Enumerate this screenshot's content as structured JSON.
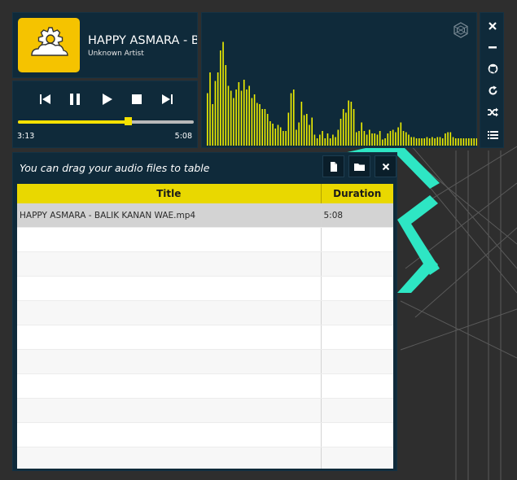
{
  "now_playing": {
    "title": "HAPPY ASMARA - BALIK KANAN WAE",
    "artist": "Unknown Artist",
    "cover_color": "#f5c300"
  },
  "controls": {
    "buttons": [
      "previous",
      "pause",
      "play",
      "stop",
      "next"
    ],
    "current_time": "3:13",
    "total_time": "5:08",
    "progress": 0.626
  },
  "visualizer": {
    "bar_color": "#f0f000",
    "levels": [
      0.43,
      0.6,
      0.34,
      0.53,
      0.6,
      0.78,
      0.85,
      0.66,
      0.49,
      0.45,
      0.39,
      0.46,
      0.52,
      0.45,
      0.54,
      0.46,
      0.49,
      0.39,
      0.42,
      0.35,
      0.34,
      0.3,
      0.3,
      0.26,
      0.2,
      0.18,
      0.14,
      0.17,
      0.15,
      0.12,
      0.12,
      0.27,
      0.43,
      0.46,
      0.13,
      0.19,
      0.36,
      0.25,
      0.26,
      0.17,
      0.23,
      0.09,
      0.06,
      0.09,
      0.12,
      0.06,
      0.1,
      0.06,
      0.09,
      0.07,
      0.13,
      0.22,
      0.3,
      0.27,
      0.37,
      0.36,
      0.3,
      0.11,
      0.12,
      0.19,
      0.12,
      0.09,
      0.13,
      0.1,
      0.1,
      0.09,
      0.12,
      0.05,
      0.06,
      0.1,
      0.12,
      0.13,
      0.11,
      0.15,
      0.19,
      0.12,
      0.11,
      0.09,
      0.07,
      0.07,
      0.06,
      0.06,
      0.06,
      0.06,
      0.07,
      0.06,
      0.07,
      0.06,
      0.07,
      0.07,
      0.06,
      0.1,
      0.11,
      0.11,
      0.07,
      0.06,
      0.06,
      0.06,
      0.06,
      0.06,
      0.06,
      0.06,
      0.06,
      0.06
    ]
  },
  "sidebar": {
    "buttons": [
      "close",
      "minimize",
      "github",
      "repeat",
      "shuffle",
      "playlist"
    ]
  },
  "playlist": {
    "hint": "You can drag your audio files to table",
    "buttons": [
      "add-file",
      "add-folder",
      "clear"
    ],
    "columns": [
      "Title",
      "Duration"
    ],
    "rows": [
      {
        "title": "HAPPY ASMARA - BALIK KANAN WAE.mp4",
        "duration": "5:08"
      }
    ],
    "empty_rows": 10
  },
  "colors": {
    "background": "#2e2e2e",
    "panel": "#0f2a3a",
    "accent_yellow": "#e9d800",
    "accent_teal": "#2ee6c4"
  }
}
